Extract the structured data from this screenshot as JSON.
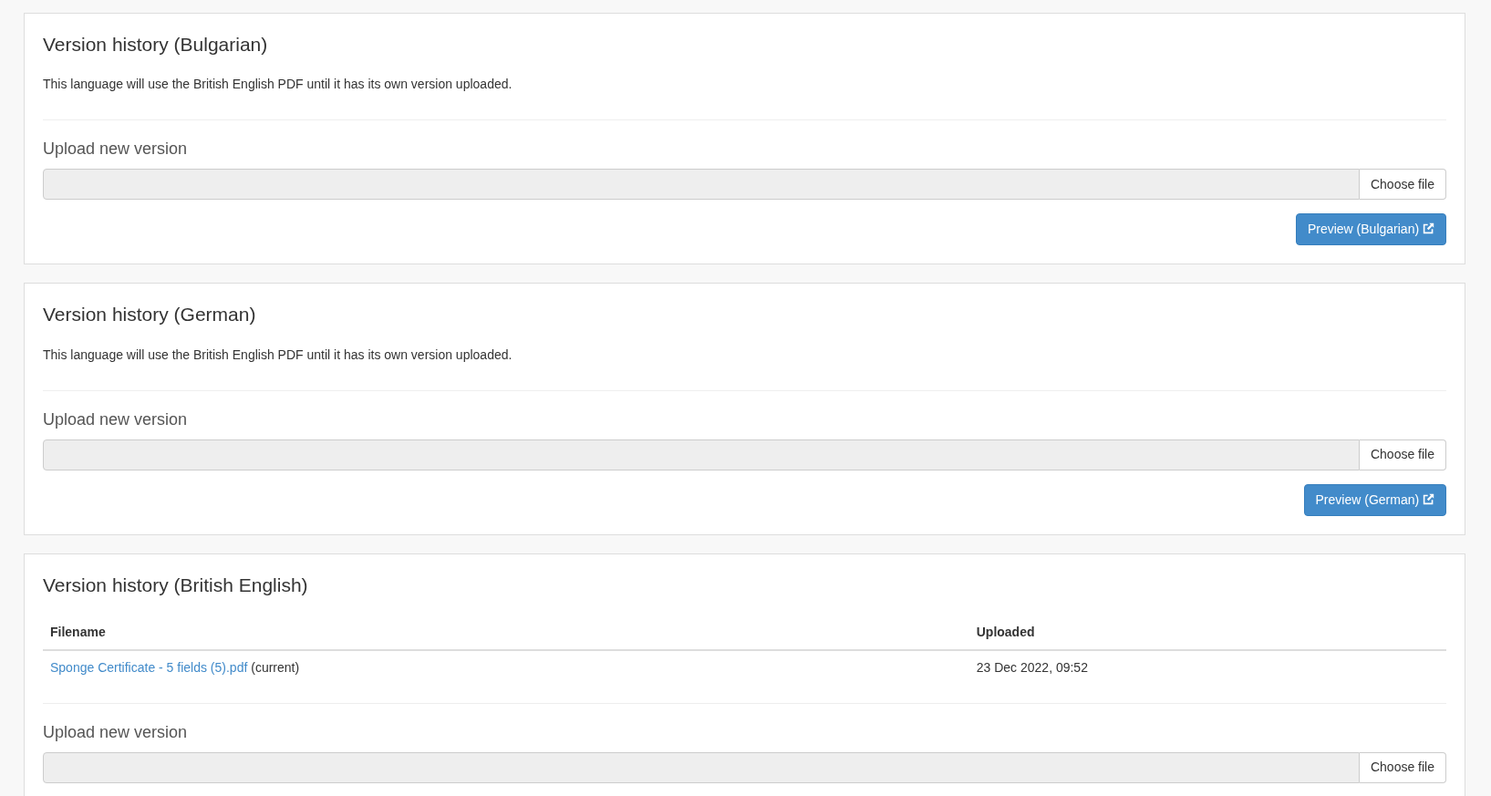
{
  "panels": [
    {
      "title": "Version history (Bulgarian)",
      "kind": "notice",
      "notice": "This language will use the British English PDF until it has its own version uploaded.",
      "upload_label": "Upload new version",
      "file_button": "Choose file",
      "preview_button": "Preview (Bulgarian)"
    },
    {
      "title": "Version history (German)",
      "kind": "notice",
      "notice": "This language will use the British English PDF until it has its own version uploaded.",
      "upload_label": "Upload new version",
      "file_button": "Choose file",
      "preview_button": "Preview (German)"
    },
    {
      "title": "Version history (British English)",
      "kind": "table",
      "table": {
        "columns": [
          "Filename",
          "Uploaded"
        ],
        "rows": [
          {
            "filename": "Sponge Certificate - 5 fields (5).pdf",
            "note": "(current)",
            "uploaded": "23 Dec 2022, 09:52"
          }
        ]
      },
      "upload_label": "Upload new version",
      "file_button": "Choose file"
    }
  ]
}
